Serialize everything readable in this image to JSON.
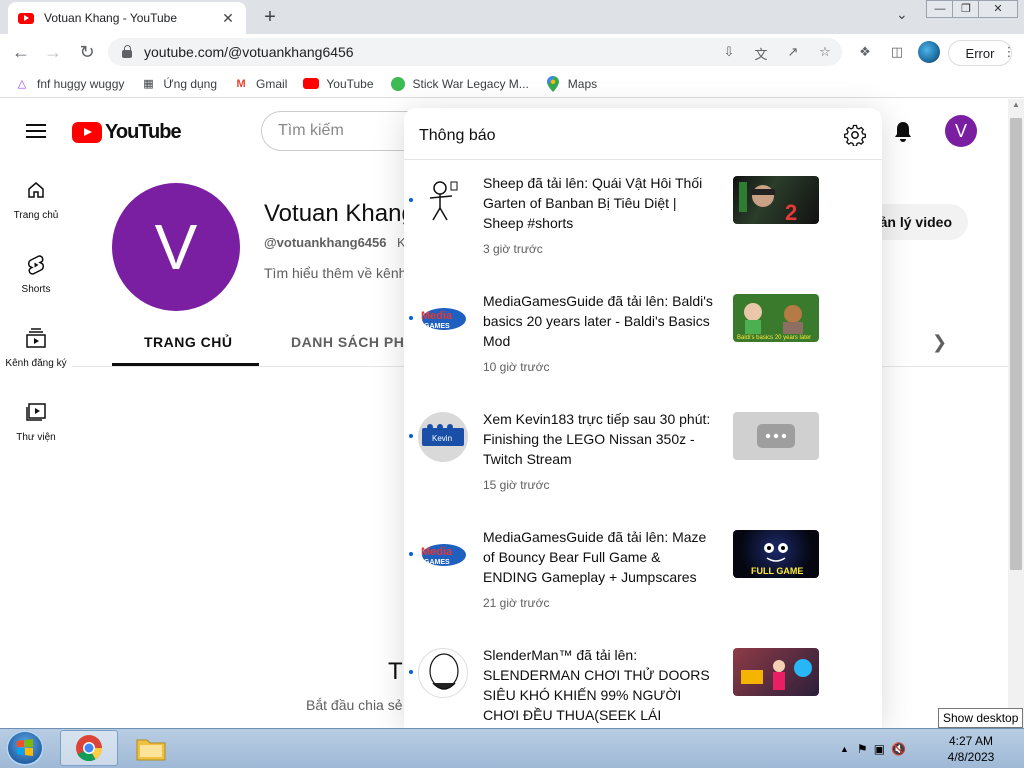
{
  "browser": {
    "tab_title": "Votuan Khang - YouTube",
    "tab_close": "✕",
    "new_tab": "+",
    "tab_dropdown": "⌄",
    "url": "youtube.com/@votuankhang6456",
    "error_label": "Error",
    "window_buttons": [
      "—",
      "❐",
      "✕"
    ],
    "bookmarks": [
      {
        "label": "fnf huggy wuggy",
        "icon": "triangle-icon"
      },
      {
        "label": "Ứng dụng",
        "icon": "apps-grid-icon"
      },
      {
        "label": "Gmail",
        "icon": "gmail-icon"
      },
      {
        "label": "YouTube",
        "icon": "youtube-icon"
      },
      {
        "label": "Stick War Legacy M...",
        "icon": "stickwar-icon"
      },
      {
        "label": "Maps",
        "icon": "maps-pin-icon"
      }
    ]
  },
  "youtube": {
    "logo_text": "YouTube",
    "search_placeholder": "Tìm kiếm",
    "user_initial": "V",
    "sidebar": [
      {
        "label": "Trang chủ",
        "icon": "home-icon"
      },
      {
        "label": "Shorts",
        "icon": "shorts-icon"
      },
      {
        "label": "Kênh đăng ký",
        "icon": "subscriptions-icon"
      },
      {
        "label": "Thư viện",
        "icon": "library-icon"
      }
    ],
    "channel": {
      "avatar_initial": "V",
      "name": "Votuan Khang",
      "handle": "@votuankhang6456",
      "meta": "K",
      "description": "Tìm hiểu thêm về kênh",
      "manage_button": "ản lý video",
      "tabs": [
        "TRANG CHỦ",
        "DANH SÁCH PHÁ"
      ]
    },
    "empty_title": "T",
    "empty_subtitle": "Bắt đầu chia sẻ"
  },
  "notifications": {
    "title": "Thông báo",
    "items": [
      {
        "text": "Sheep đã tải lên: Quái Vật Hôi Thối Garten of Banban Bị Tiêu Diệt | Sheep #shorts",
        "time": "3 giờ trước"
      },
      {
        "text": "MediaGamesGuide đã tải lên: Baldi's basics 20 years later - Baldi's Basics Mod",
        "time": "10 giờ trước"
      },
      {
        "text": "Xem Kevin183 trực tiếp sau 30 phút: Finishing the LEGO Nissan 350z - Twitch Stream",
        "time": "15 giờ trước",
        "avatar_text": "Kevin"
      },
      {
        "text": "MediaGamesGuide đã tải lên: Maze of Bouncy Bear Full Game & ENDING Gameplay + Jumpscares",
        "time": "21 giờ trước"
      },
      {
        "text": "SlenderMan™ đã tải lên: SLENDERMAN CHƠI THỬ DOORS SIÊU KHÓ KHIẾN 99% NGƯỜI CHƠI ĐỀU THUA(SEEK LÁI XE.JEFF THE",
        "time": ""
      }
    ],
    "thumb_labels": [
      "Baldi's basics 20 years later",
      "FULL GAME"
    ],
    "media_logo": [
      "Media",
      "GAMES"
    ]
  },
  "taskbar": {
    "time": "4:27 AM",
    "date": "4/8/2023",
    "tooltip": "Show desktop"
  },
  "colors": {
    "youtube_red": "#ff0000",
    "avatar_purple": "#7b1fa2",
    "unread_blue": "#065fd4"
  }
}
